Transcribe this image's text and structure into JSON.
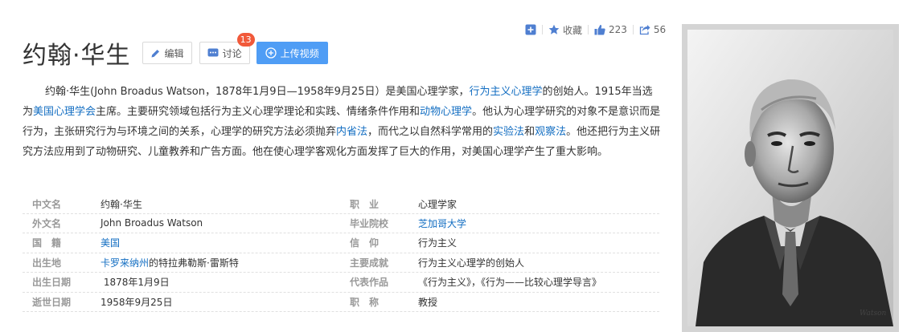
{
  "toolbar": {
    "collect_label": "收藏",
    "like_count": "223",
    "share_count": "56"
  },
  "header": {
    "title": "约翰·华生",
    "edit_label": "编辑",
    "discuss_label": "讨论",
    "discuss_badge": "13",
    "upload_label": "上传视频"
  },
  "summary": {
    "p1": "约翰·华生(John Broadus Watson，1878年1月9日—1958年9月25日）是美国心理学家，",
    "link1": "行为主义心理学",
    "p2": "的创始人。1915年当选为",
    "link2": "美国心理学会",
    "p3": "主席。主要研究领域包括行为主义心理学理论和实践、情绪条件作用和",
    "link3": "动物心理学",
    "p4": "。他认为心理学研究的对象不是意识而是行为，主张研究行为与环境之间的关系，心理学的研究方法必须抛弃",
    "link4": "内省法",
    "p5": "，而代之以自然科学常用的",
    "link5": "实验法",
    "p6": "和",
    "link6": "观察法",
    "p7": "。他还把行为主义研究方法应用到了动物研究、儿童教养和广告方面。他在使心理学客观化方面发挥了巨大的作用，对美国心理学产生了重大影响。"
  },
  "basic_info": {
    "rows": [
      {
        "k1": "中文名",
        "v1": "约翰·华生",
        "k2": "职　业",
        "v2": "心理学家"
      },
      {
        "k1": "外文名",
        "v1": "John Broadus Watson",
        "k2": "毕业院校",
        "v2": "芝加哥大学"
      },
      {
        "k1": "国　籍",
        "v1": "美国",
        "k2": "信　仰",
        "v2": "行为主义"
      },
      {
        "k1": "出生地",
        "v1a": "卡罗来纳州",
        "v1b": "的特拉弗勒斯·雷斯特",
        "k2": "主要成就",
        "v2": "行为主义心理学的创始人"
      },
      {
        "k1": "出生日期",
        "v1": " 1878年1月9日",
        "k2": "代表作品",
        "v2": "《行为主义》，《行为——比较心理学导言》"
      },
      {
        "k1": "逝世日期",
        "v1": "1958年9月25日",
        "k2": "职　称",
        "v2": "教授"
      }
    ]
  },
  "photo": {
    "signature": "Watson"
  },
  "colors": {
    "link": "#136ec2",
    "accent_button": "#4f9df5",
    "badge": "#f1593a"
  }
}
